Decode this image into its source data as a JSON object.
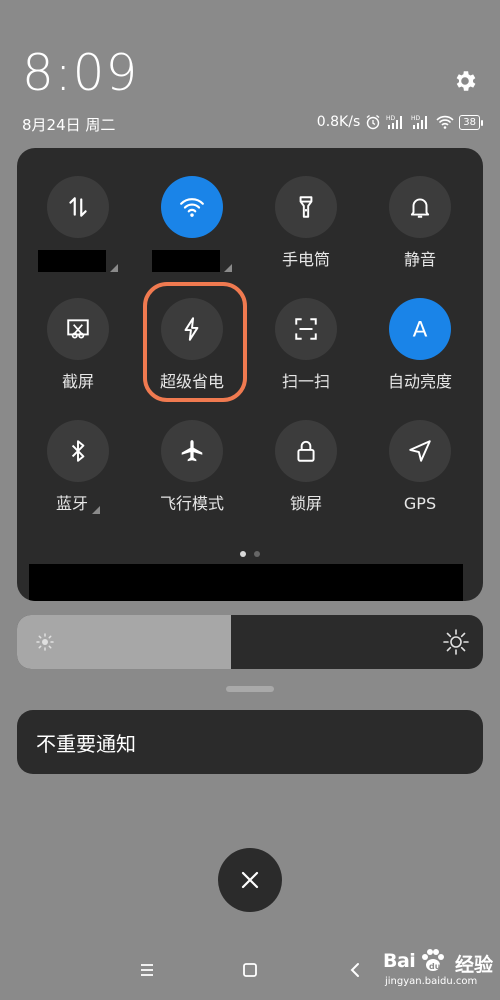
{
  "status": {
    "time": "8:09",
    "date": "8月24日 周二",
    "network_speed": "0.8K/s",
    "battery": "38"
  },
  "tiles": [
    {
      "name": "tile-mobile-data",
      "icon": "data-arrows-icon",
      "label": "",
      "active": false
    },
    {
      "name": "tile-wifi",
      "icon": "wifi-icon",
      "label": "",
      "active": true
    },
    {
      "name": "tile-flashlight",
      "icon": "flashlight-icon",
      "label": "手电筒",
      "active": false
    },
    {
      "name": "tile-silent",
      "icon": "bell-icon",
      "label": "静音",
      "active": false
    },
    {
      "name": "tile-screenshot",
      "icon": "screenshot-icon",
      "label": "截屏",
      "active": false
    },
    {
      "name": "tile-ultra-battery-saver",
      "icon": "lightning-icon",
      "label": "超级省电",
      "active": false
    },
    {
      "name": "tile-scan",
      "icon": "scan-icon",
      "label": "扫一扫",
      "active": false
    },
    {
      "name": "tile-auto-brightness",
      "icon": "auto-brightness-icon",
      "label": "自动亮度",
      "active": true
    },
    {
      "name": "tile-bluetooth",
      "icon": "bluetooth-icon",
      "label": "蓝牙",
      "active": false
    },
    {
      "name": "tile-airplane-mode",
      "icon": "airplane-icon",
      "label": "飞行模式",
      "active": false
    },
    {
      "name": "tile-lock-screen",
      "icon": "lock-icon",
      "label": "锁屏",
      "active": false
    },
    {
      "name": "tile-gps",
      "icon": "gps-icon",
      "label": "GPS",
      "active": false
    }
  ],
  "auto_brightness_letter": "A",
  "page_indicator": {
    "pages": 2,
    "current": 1
  },
  "brightness": {
    "level": 0.46
  },
  "notification": {
    "label": "不重要通知"
  },
  "watermark": {
    "brand": "Bai",
    "brand2": "经验",
    "url": "jingyan.baidu.com"
  },
  "colors": {
    "accent": "#1a84e8",
    "highlight": "#f07a50",
    "panel": "#2b2b2b",
    "background": "#8a8a8a"
  }
}
